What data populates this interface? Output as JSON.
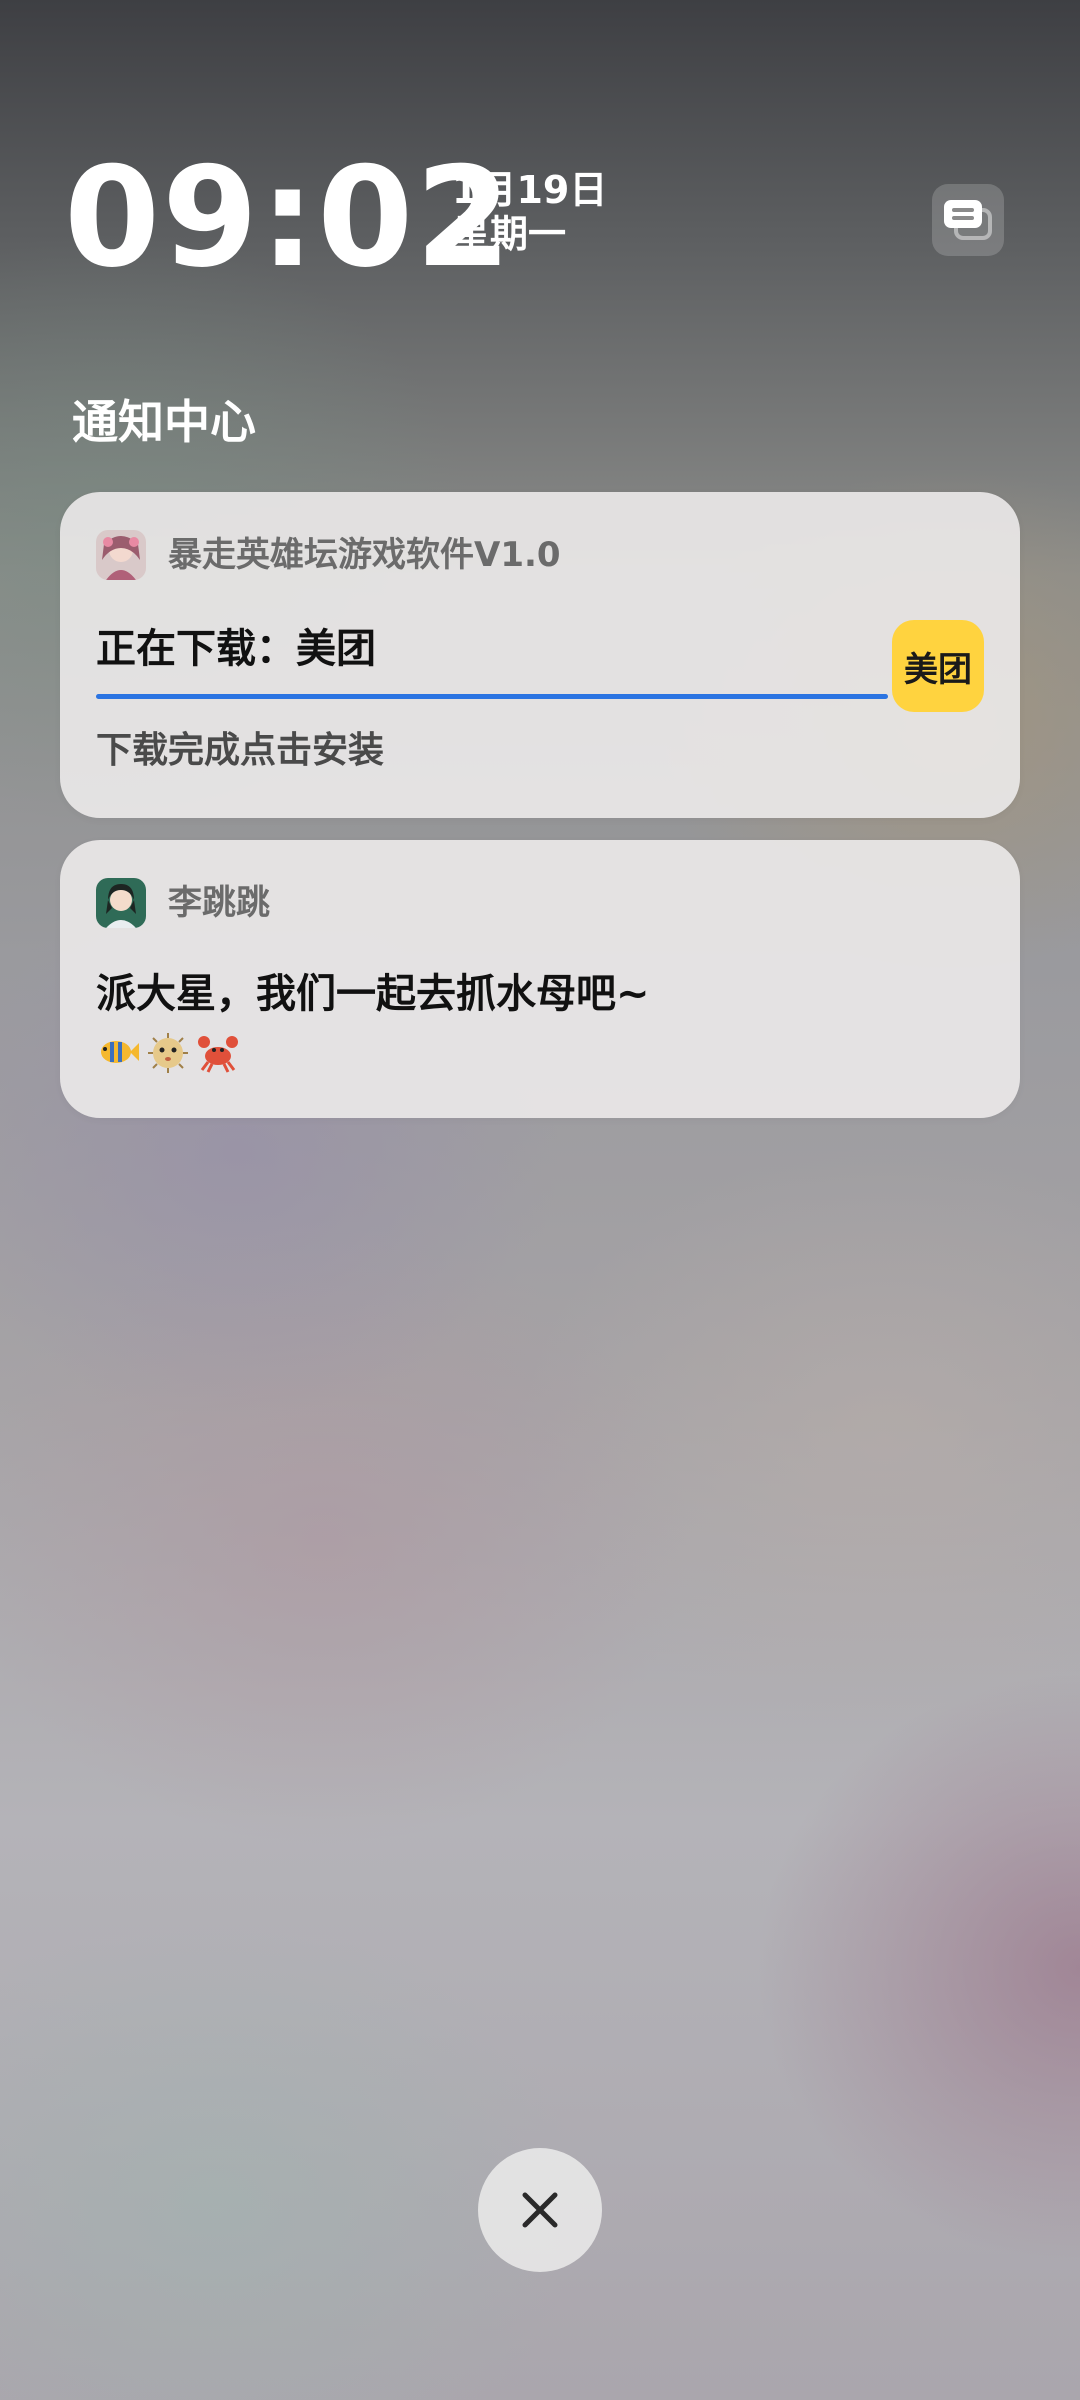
{
  "lockscreen": {
    "time": "09:02",
    "date": "1月19日",
    "weekday": "星期一"
  },
  "notification_center": {
    "title": "通知中心"
  },
  "notifications": [
    {
      "app_name": "暴走英雄坛游戏软件V1.0",
      "title": "正在下载：美团",
      "subtitle": "下载完成点击安装",
      "progress": 1.0,
      "download_icon_text": "美团",
      "download_icon_color": "#ffd33f"
    },
    {
      "app_name": "李跳跳",
      "message": "派大星，我们一起去抓水母吧~",
      "emoji_icons": [
        "tropical-fish-icon",
        "blowfish-icon",
        "crab-icon"
      ]
    }
  ],
  "colors": {
    "accent": "#2b74e2",
    "meituan_yellow": "#ffd33f"
  }
}
